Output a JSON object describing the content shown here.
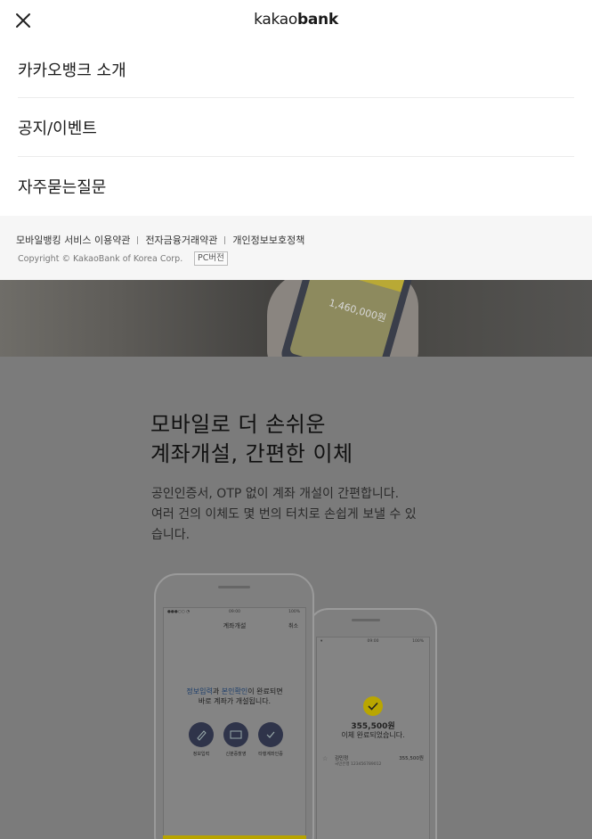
{
  "header": {
    "logo_light": "kakao",
    "logo_bold": "bank",
    "close_icon": "close-icon"
  },
  "menu": {
    "items": [
      {
        "label": "카카오뱅크 소개"
      },
      {
        "label": "공지/이벤트"
      },
      {
        "label": "자주묻는질문"
      }
    ]
  },
  "footer": {
    "links": [
      "모바일뱅킹 서비스 이용약관",
      "전자금융거래약관",
      "개인정보보호정책"
    ],
    "copyright": "Copyright © KakaoBank of Korea Corp.",
    "pc_button": "PC버전"
  },
  "background": {
    "photo_amount": "1,460,000원",
    "headline_line1": "모바일로 더 손쉬운",
    "headline_line2": "계좌개설, 간편한 이체",
    "desc_line1": "공인인증서, OTP 없이 계좌 개설이 간편합니다.",
    "desc_line2": "여러 건의 이체도 몇 번의 터치로 손쉽게 보낼 수 있",
    "desc_line3": "습니다.",
    "phone1": {
      "time": "09:00",
      "battery": "100%",
      "title": "계좌개설",
      "cancel": "취소",
      "msg_blue1": "정보입력",
      "msg_mid": "과 ",
      "msg_blue2": "본인확인",
      "msg_end": "이 완료되면",
      "msg_line2": "바로 계좌가 개설됩니다.",
      "steps": [
        "정보입력",
        "신분증촬영",
        "타행계좌인증"
      ]
    },
    "phone2": {
      "time": "09:00",
      "battery": "100%",
      "amount": "355,500원",
      "done": "이체 완료되었습니다.",
      "tx_name": "김민정",
      "tx_acct": "국민은행 123456789012",
      "tx_value": "355,500원"
    }
  },
  "colors": {
    "accent_yellow": "#b9a600",
    "dim_overlay": "#7b7b7b",
    "footer_bg": "#f6f6f6"
  }
}
